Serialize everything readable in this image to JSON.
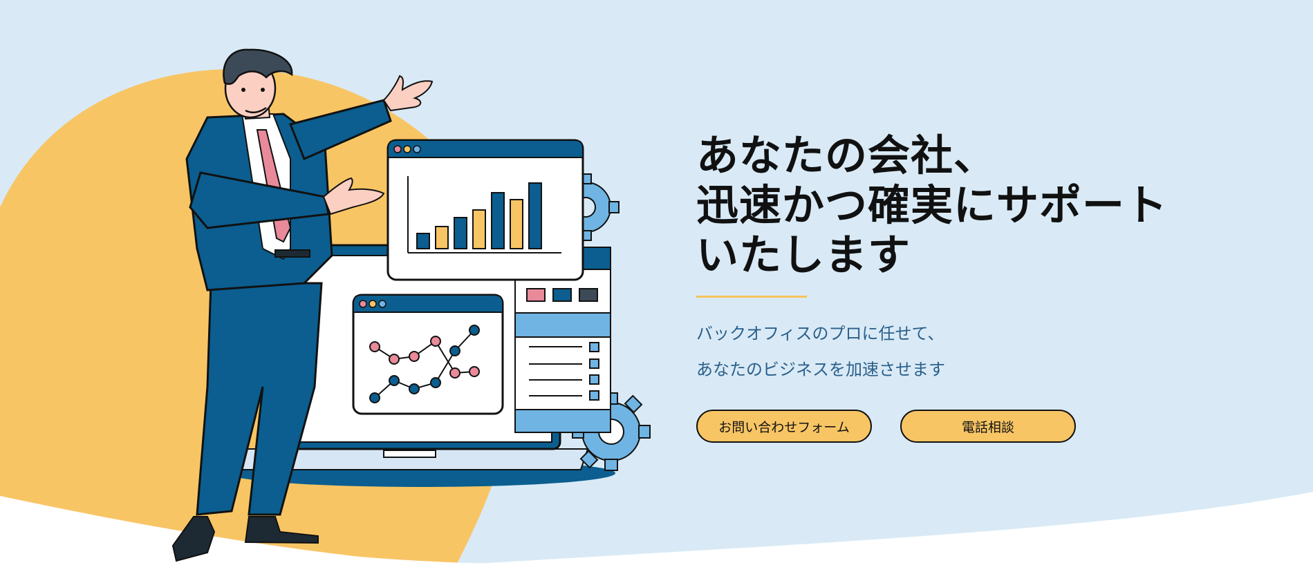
{
  "hero": {
    "headline": [
      "あなたの会社、",
      "迅速かつ確実にサポート",
      "いたします"
    ],
    "subtext": [
      "バックオフィスのプロに任せて、",
      "あなたのビジネスを加速させます"
    ],
    "buttons": {
      "contact_form": "お問い合わせフォーム",
      "phone_consult": "電話相談"
    }
  },
  "colors": {
    "background": "#d9eaf6",
    "accent_yellow": "#f8c565",
    "navy": "#0b5e8f",
    "light_blue": "#6fb4e3",
    "pink": "#e98a9a",
    "text_dark": "#111111",
    "sub_text": "#2b5f8a"
  },
  "illustration": {
    "subject": "businessman presenting dashboard icons",
    "icons": [
      "bar-chart-window-icon",
      "line-chart-window-icon",
      "list-panel-icon",
      "gear-icon",
      "laptop-icon"
    ]
  }
}
